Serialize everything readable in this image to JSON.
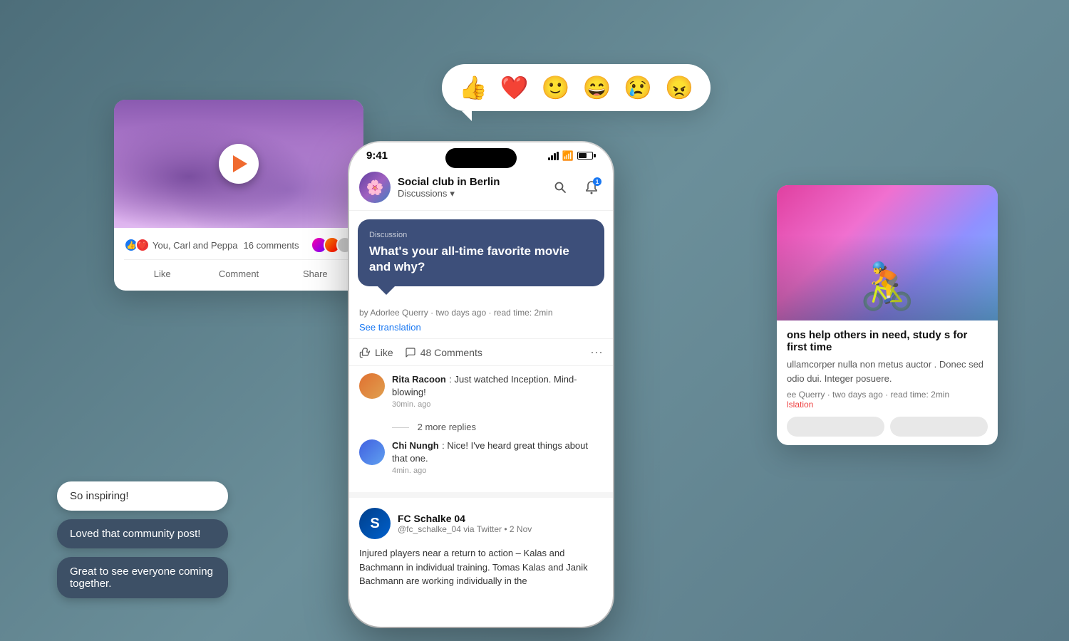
{
  "background": {
    "color": "#5a7a85"
  },
  "emoji_bar": {
    "emojis": [
      "👍",
      "❤️",
      "😊",
      "😄",
      "😢",
      "😠"
    ],
    "emoji_colors": [
      "#e56e2e",
      "#e03030",
      "#e05a20",
      "#e05a20",
      "#e05a20",
      "#e05a20"
    ]
  },
  "left_card": {
    "reactions_text": "You, Carl and Peppa",
    "comments": "16 comments",
    "like_btn": "Like",
    "comment_btn": "Comment",
    "share_btn": "Share"
  },
  "chat_bubbles": [
    {
      "text": "So inspiring!",
      "style": "light"
    },
    {
      "text": "Loved that community post!",
      "style": "dark"
    },
    {
      "text": "Great to see everyone coming together.",
      "style": "dark"
    }
  ],
  "phone": {
    "status_time": "9:41",
    "group_name": "Social club in Berlin",
    "group_tab": "Discussions",
    "search_icon": "search",
    "notif_icon": "bell",
    "notif_count": "1",
    "discussion": {
      "label": "Discussion",
      "title": "What's your all-time favorite movie and why?",
      "author": "Adorlee Querry",
      "time_ago": "two days ago",
      "read_time": "2min",
      "see_translation": "See translation"
    },
    "actions": {
      "like": "Like",
      "comments_count": "48 Comments"
    },
    "comments": [
      {
        "author": "Rita Racoon",
        "text": "Just watched Inception. Mind-blowing!",
        "time": "30min. ago",
        "more_replies": "2 more replies"
      },
      {
        "author": "Chi Nungh",
        "text": "Nice! I've heard great things about that one.",
        "time": "4min. ago"
      }
    ],
    "second_post": {
      "page_name": "FC Schalke 04",
      "handle": "@fc_schalke_04 via Twitter",
      "date": "2 Nov",
      "text": "Injured players near a return to action – Kalas and Bachmann in individual training. Tomas Kalas and Janik Bachmann are working individually in the"
    }
  },
  "right_card": {
    "title": "ons help others in need, study s for first time",
    "body": "ullamcorper nulla non metus auctor . Donec sed odio dui. Integer posuere.",
    "author": "ee Querry",
    "time_ago": "two days ago",
    "read_time": "2min",
    "translation_link": "lslation"
  }
}
